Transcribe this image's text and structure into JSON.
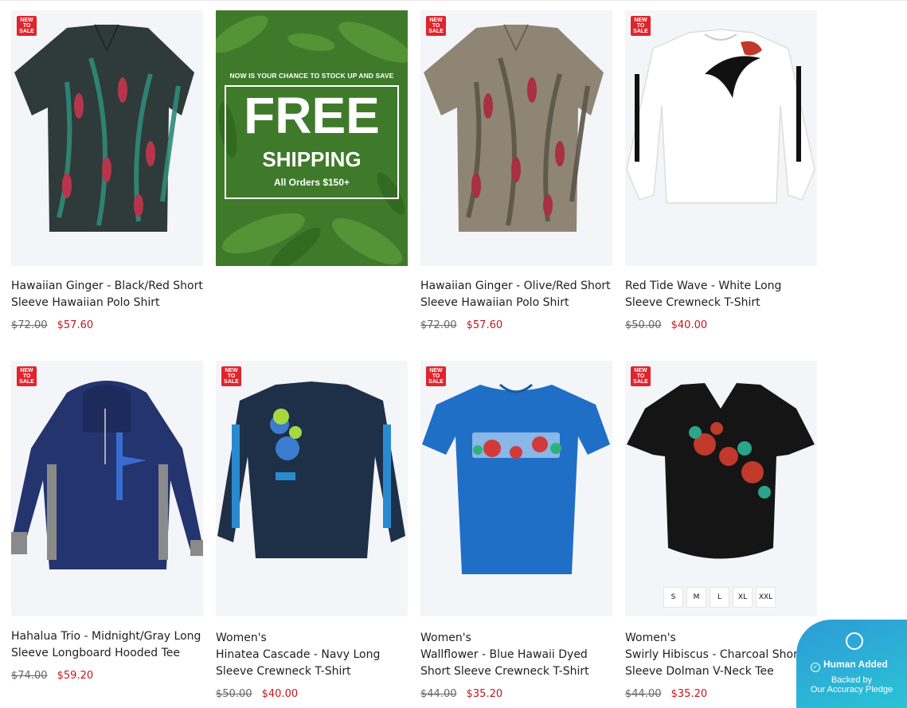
{
  "badge": {
    "line1": "NEW",
    "line2": "TO",
    "line3": "SALE"
  },
  "banner": {
    "top_text": "NOW IS YOUR CHANCE TO STOCK UP AND SAVE",
    "headline": "FREE",
    "subline": "SHIPPING",
    "note": "All Orders $150+"
  },
  "products": [
    {
      "title": "Hawaiian Ginger - Black/Red Short Sleeve Hawaiian Polo Shirt",
      "old_price": "$72.00",
      "new_price": "$57.60"
    },
    {
      "title": "Hawaiian Ginger - Olive/Red Short Sleeve Hawaiian Polo Shirt",
      "old_price": "$72.00",
      "new_price": "$57.60"
    },
    {
      "title": "Red Tide Wave - White Long Sleeve Crewneck T-Shirt",
      "old_price": "$50.00",
      "new_price": "$40.00"
    },
    {
      "title": "Hahalua Trio - Midnight/Gray Long Sleeve Longboard Hooded Tee",
      "old_price": "$74.00",
      "new_price": "$59.20"
    },
    {
      "category": "Women's",
      "title": "Hinatea Cascade - Navy Long Sleeve Crewneck T-Shirt",
      "old_price": "$50.00",
      "new_price": "$40.00"
    },
    {
      "category": "Women's",
      "title": "Wallflower - Blue Hawaii Dyed Short Sleeve Crewneck T-Shirt",
      "old_price": "$44.00",
      "new_price": "$35.20"
    },
    {
      "category": "Women's",
      "title": "Swirly Hibiscus - Charcoal Short Sleeve Dolman V-Neck Tee",
      "old_price": "$44.00",
      "new_price": "$35.20"
    }
  ],
  "size_options": [
    "S",
    "M",
    "L",
    "XL",
    "XXL"
  ],
  "pledge": {
    "title": "Human Added",
    "line1": "Backed by",
    "line2": "Our Accuracy Pledge"
  },
  "colors": {
    "sale_red": "#c4161c",
    "badge_red": "#e0242c",
    "banner_green": "#3f7a2a",
    "pledge_blue": "#2d9bd6"
  }
}
